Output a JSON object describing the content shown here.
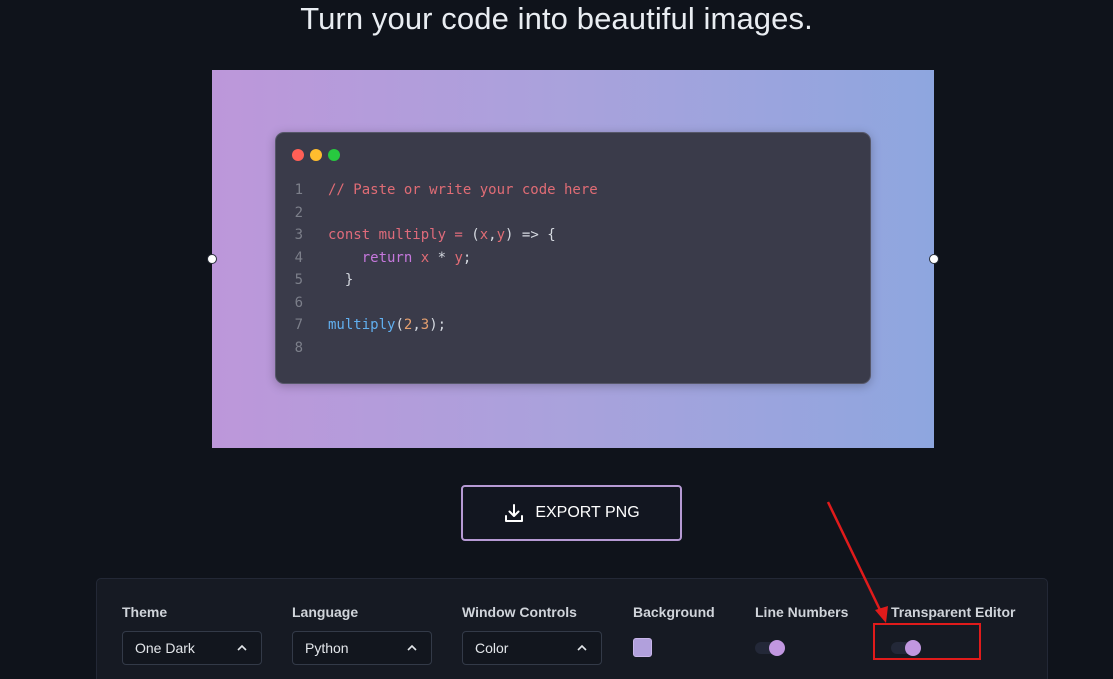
{
  "header": {
    "title": "Turn your code into beautiful images."
  },
  "editor": {
    "window_controls": [
      "close-dot",
      "minimize-dot",
      "maximize-dot"
    ],
    "lines": [
      {
        "number": "1",
        "tokens": [
          {
            "text": "// Paste or write your code here",
            "kind": "comment"
          }
        ]
      },
      {
        "number": "2",
        "tokens": []
      },
      {
        "number": "3",
        "tokens": [
          {
            "text": "const multiply = ",
            "kind": "keyword"
          },
          {
            "text": "(",
            "kind": "plain"
          },
          {
            "text": "x",
            "kind": "param"
          },
          {
            "text": ",",
            "kind": "plain"
          },
          {
            "text": "y",
            "kind": "param"
          },
          {
            "text": ") => {",
            "kind": "plain"
          }
        ]
      },
      {
        "number": "4",
        "tokens": [
          {
            "text": "    return ",
            "kind": "return"
          },
          {
            "text": "x",
            "kind": "param"
          },
          {
            "text": " * ",
            "kind": "plain"
          },
          {
            "text": "y",
            "kind": "param"
          },
          {
            "text": ";",
            "kind": "plain"
          }
        ]
      },
      {
        "number": "5",
        "tokens": [
          {
            "text": "  }",
            "kind": "plain"
          }
        ]
      },
      {
        "number": "6",
        "tokens": []
      },
      {
        "number": "7",
        "tokens": [
          {
            "text": "multiply",
            "kind": "fn"
          },
          {
            "text": "(",
            "kind": "plain"
          },
          {
            "text": "2",
            "kind": "num"
          },
          {
            "text": ",",
            "kind": "plain"
          },
          {
            "text": "3",
            "kind": "num"
          },
          {
            "text": ");",
            "kind": "plain"
          }
        ]
      },
      {
        "number": "8",
        "tokens": []
      }
    ]
  },
  "export": {
    "label": "EXPORT PNG",
    "icon": "download-icon"
  },
  "settings": {
    "theme": {
      "label": "Theme",
      "value": "One Dark"
    },
    "language": {
      "label": "Language",
      "value": "Python"
    },
    "window_controls": {
      "label": "Window Controls",
      "value": "Color"
    },
    "background": {
      "label": "Background",
      "color": "#b1a0dc"
    },
    "line_numbers": {
      "label": "Line Numbers",
      "enabled": true
    },
    "transparent_editor": {
      "label": "Transparent Editor",
      "enabled": true
    }
  },
  "colors": {
    "page_bg": "#0f131b",
    "gradient_start": "#bd97da",
    "gradient_end": "#8ea6df",
    "editor_bg": "#3a3b4a",
    "accent": "#c197e0",
    "annotation": "#e01b1b"
  }
}
